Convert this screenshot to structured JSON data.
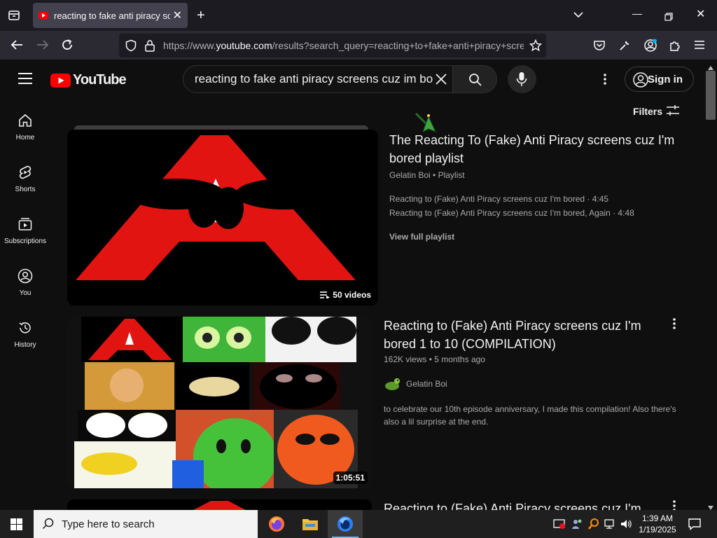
{
  "browser": {
    "tab_title": "reacting to fake anti piracy scree",
    "url_prefix": "https://www.",
    "url_domain": "youtube.com",
    "url_rest": "/results?search_query=reacting+to+fake+anti+piracy+scre"
  },
  "header": {
    "logo_text": "YouTube",
    "search_value": "reacting to fake anti piracy screens cuz im bored",
    "sign_in_label": "Sign in"
  },
  "sidebar": {
    "items": [
      {
        "label": "Home"
      },
      {
        "label": "Shorts"
      },
      {
        "label": "Subscriptions"
      },
      {
        "label": "You"
      },
      {
        "label": "History"
      }
    ]
  },
  "filters_label": "Filters",
  "results": [
    {
      "title": "The Reacting To (Fake) Anti Piracy screens cuz I'm bored playlist",
      "channel": "Gelatin Boi",
      "kind": "Playlist",
      "items": [
        "Reacting to (Fake) Anti Piracy screens cuz I'm bored · 4:45",
        "Reacting to (Fake) Anti Piracy screens cuz I'm bored, Again · 4:48"
      ],
      "view_full": "View full playlist",
      "badge": "50 videos"
    },
    {
      "title": "Reacting to (Fake) Anti Piracy screens cuz I'm bored 1 to 10 (COMPILATION)",
      "views": "162K views",
      "age": "5 months ago",
      "channel": "Gelatin Boi",
      "description": "to celebrate our 10th episode anniversary, I made this compilation! Also there's also a lil surprise at the end.",
      "duration": "1:05:51"
    },
    {
      "title": "Reacting to (Fake) Anti Piracy screens cuz I'm"
    }
  ],
  "taskbar": {
    "search_placeholder": "Type here to search",
    "time": "1:39 AM",
    "date": "1/19/2025"
  }
}
